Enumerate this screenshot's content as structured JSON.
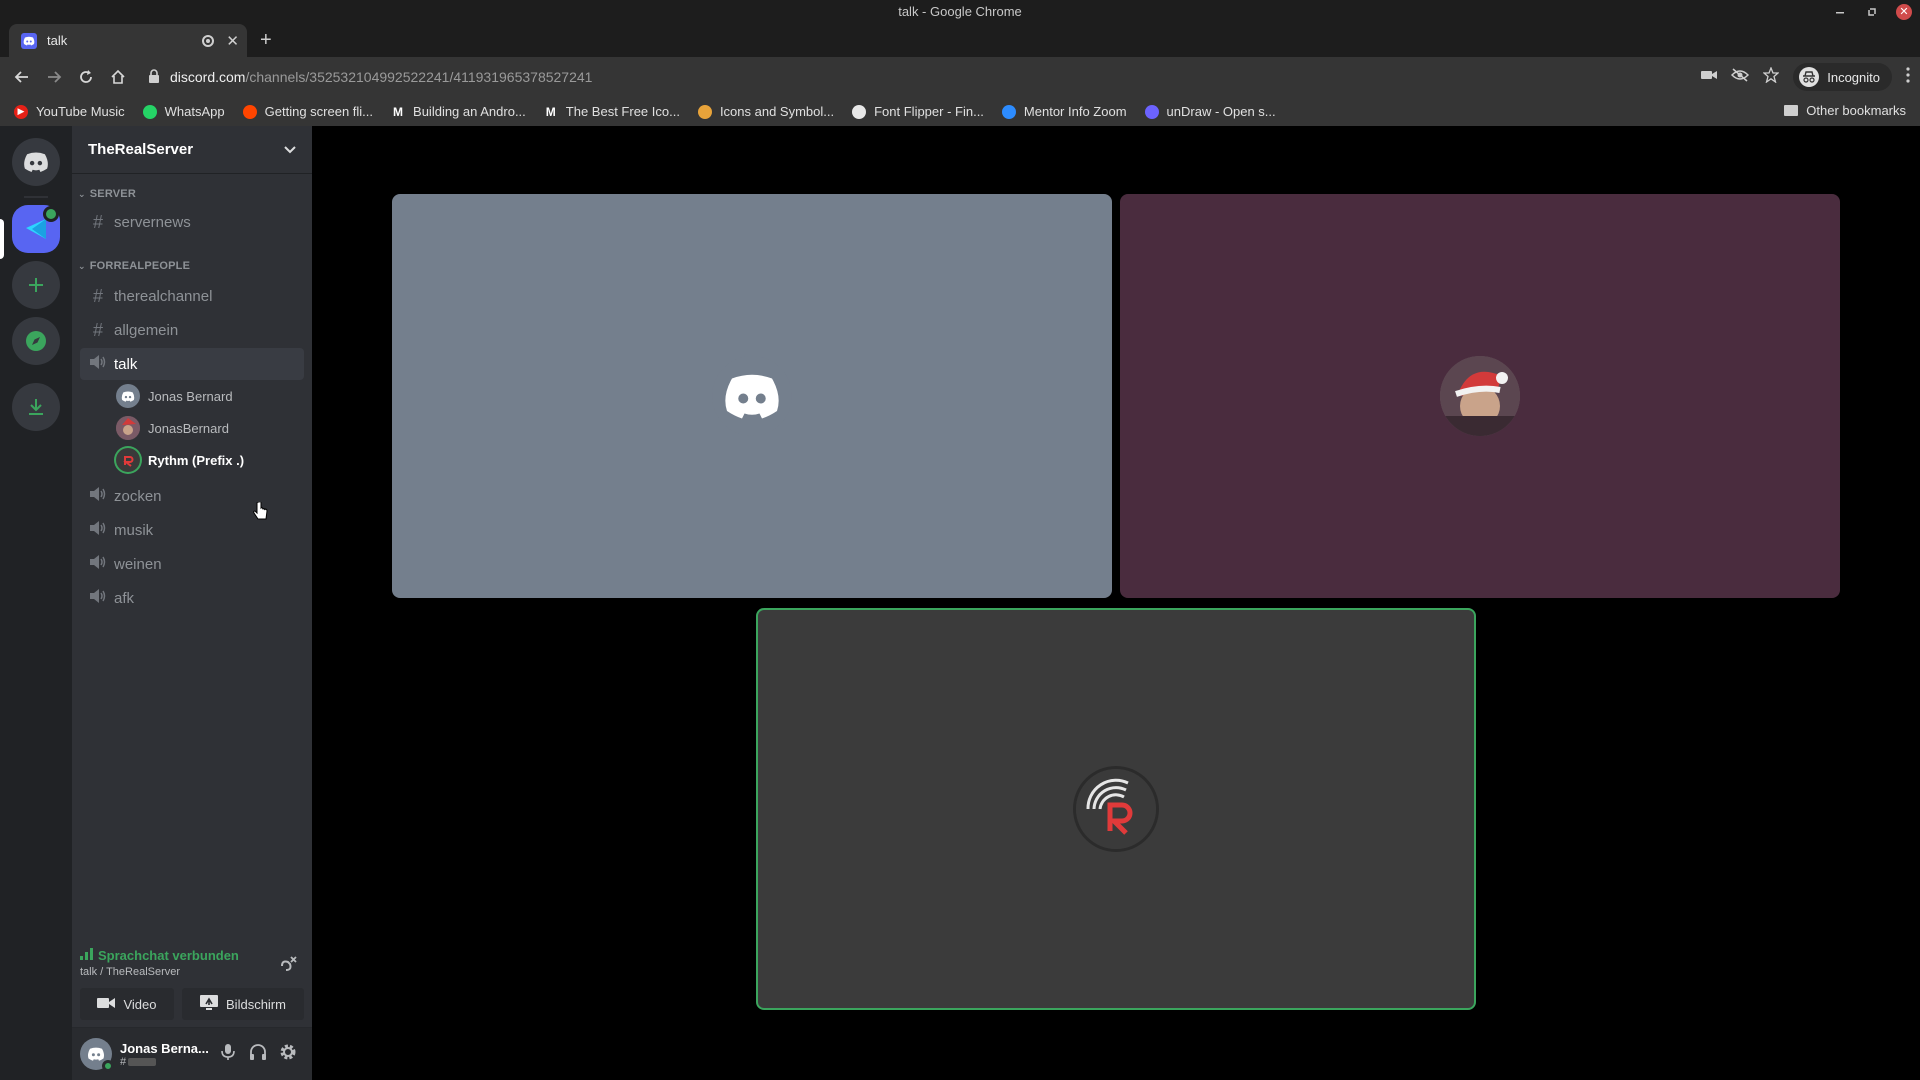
{
  "window": {
    "title": "talk - Google Chrome"
  },
  "tab": {
    "title": "talk"
  },
  "address_bar": {
    "host": "discord.com",
    "path": "/channels/352532104992522241/411931965378527241"
  },
  "profile": {
    "label": "Incognito"
  },
  "bookmarks": [
    {
      "label": "YouTube Music",
      "icon": "youtube-music-icon",
      "color": "#e62117",
      "glyph": "▶"
    },
    {
      "label": "WhatsApp",
      "icon": "whatsapp-icon",
      "color": "#25d366",
      "glyph": ""
    },
    {
      "label": "Getting screen fli...",
      "icon": "reddit-icon",
      "color": "#ff4500",
      "glyph": ""
    },
    {
      "label": "Building an Andro...",
      "icon": "medium-icon",
      "color": "#353535",
      "glyph": "M"
    },
    {
      "label": "The Best Free Ico...",
      "icon": "medium-icon",
      "color": "#353535",
      "glyph": "M"
    },
    {
      "label": "Icons and Symbol...",
      "icon": "icons-site-icon",
      "color": "#e8a33a",
      "glyph": ""
    },
    {
      "label": "Font Flipper - Fin...",
      "icon": "font-flipper-icon",
      "color": "#e8e8e8",
      "glyph": ""
    },
    {
      "label": "Mentor Info Zoom",
      "icon": "zoom-icon",
      "color": "#2d8cff",
      "glyph": ""
    },
    {
      "label": "unDraw - Open s...",
      "icon": "undraw-icon",
      "color": "#6c63ff",
      "glyph": ""
    }
  ],
  "other_bookmarks": "Other bookmarks",
  "server": {
    "name": "TheRealServer"
  },
  "categories": [
    {
      "name": "SERVER"
    },
    {
      "name": "FORREALPEOPLE"
    }
  ],
  "text_channels_server": [
    {
      "name": "servernews"
    }
  ],
  "text_channels_people": [
    {
      "name": "therealchannel"
    },
    {
      "name": "allgemein"
    }
  ],
  "active_voice_channel": {
    "name": "talk"
  },
  "voice_users": [
    {
      "name": "Jonas Bernard",
      "speaking": false
    },
    {
      "name": "JonasBernard",
      "speaking": false
    },
    {
      "name": "Rythm (Prefix .)",
      "speaking": true
    }
  ],
  "voice_channels": [
    {
      "name": "zocken"
    },
    {
      "name": "musik"
    },
    {
      "name": "weinen"
    },
    {
      "name": "afk"
    }
  ],
  "voice_panel": {
    "status": "Sprachchat verbunden",
    "channel": "talk / TheRealServer",
    "video_label": "Video",
    "screen_label": "Bildschirm"
  },
  "user": {
    "name": "Jonas Berna...",
    "tag_prefix": "#"
  },
  "colors": {
    "accent": "#5865f2",
    "online": "#3ba55d",
    "speaking_border": "#3ba55d"
  }
}
